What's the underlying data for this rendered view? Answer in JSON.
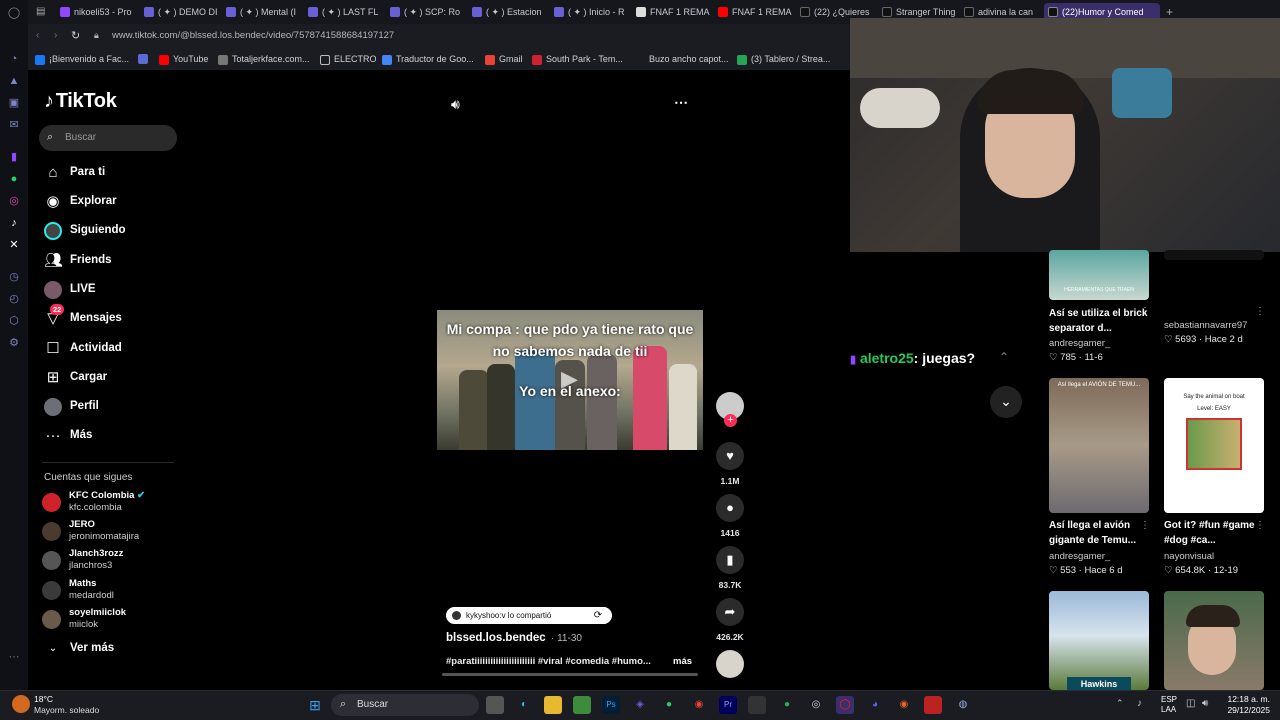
{
  "browser": {
    "tabs": [
      "nikoeli53 - Pro",
      "( ✦ ) DEMO DI",
      "( ✦ ) Mental (I",
      "( ✦ ) LAST FL",
      "( ✦ ) SCP: Ro",
      "( ✦ ) Estacion",
      "( ✦ ) Inicio - R",
      "FNAF 1 REMA",
      "FNAF 1 REMA",
      "(22) ¿Quieres",
      "Stranger Thing",
      "adivina la can",
      "(22)Humor y Comed"
    ],
    "url": "www.tiktok.com/@blssed.los.bendec/video/7578741588684197127",
    "bookmarks": [
      "¡Bienvenido a Fac...",
      "YouTube",
      "Totaljerkface.com...",
      "ELECTRO",
      "Traductor de Goo...",
      "Gmail",
      "South Park - Tem...",
      "Buzo ancho capot...",
      "(3) Tablero / Strea..."
    ]
  },
  "tiktok": {
    "logo": "TikTok",
    "search_placeholder": "Buscar",
    "nav": [
      {
        "label": "Para ti",
        "icon": "home-icon"
      },
      {
        "label": "Explorar",
        "icon": "compass-icon"
      },
      {
        "label": "Siguiendo",
        "icon": "following-icon"
      },
      {
        "label": "Friends",
        "icon": "friends-icon"
      },
      {
        "label": "LIVE",
        "icon": "live-icon"
      },
      {
        "label": "Mensajes",
        "icon": "messages-icon",
        "badge": "22"
      },
      {
        "label": "Actividad",
        "icon": "activity-icon"
      },
      {
        "label": "Cargar",
        "icon": "upload-icon"
      },
      {
        "label": "Perfil",
        "icon": "profile-icon"
      },
      {
        "label": "Más",
        "icon": "more-icon"
      }
    ],
    "following_title": "Cuentas que sigues",
    "following": [
      {
        "name": "KFC Colombia",
        "handle": "kfc.colombia",
        "verified": true
      },
      {
        "name": "JERO",
        "handle": "jeronimomatajira"
      },
      {
        "name": "Jlanch3rozz",
        "handle": "jlanchros3"
      },
      {
        "name": "Maths",
        "handle": "medardodl"
      },
      {
        "name": "soyelmiiclok",
        "handle": "miiclok"
      }
    ],
    "see_more": "Ver más"
  },
  "video": {
    "caption_top": "Mi compa : que pdo ya tiene rato que no sabemos nada de tii",
    "caption_bottom": "Yo en el anexo:",
    "likes": "1.1M",
    "comments": "1416",
    "saves": "83.7K",
    "shares": "426.2K",
    "shared_by": "kykyshoo:v lo compartió",
    "author": "blssed.los.bendec",
    "date": "· 11-30",
    "description": "#paratiiiiiiiiiiiiiiiiiiiiiii #viral #comedia #humo...",
    "more": "más"
  },
  "stream_overlay": {
    "user": "aletro25",
    "message": ": juegas?"
  },
  "grid": [
    {
      "title": "Así se utiliza el brick separator d...",
      "user": "andresgamer_",
      "stats": "♡ 785 · 11-6"
    },
    {
      "title": "",
      "user": "sebastiannavarre97",
      "stats": "♡ 5693 · Hace 2 d"
    },
    {
      "title": "Así llega el avión gigante de Temu...",
      "user": "andresgamer_",
      "stats": "♡ 553 · Hace 6 d"
    },
    {
      "title": "Got it? #fun #game #dog #ca...",
      "user": "nayonvisual",
      "stats": "♡ 654.8K · 12-19"
    },
    {
      "title": "",
      "user": "",
      "stats": ""
    },
    {
      "title": "",
      "user": "",
      "stats": ""
    }
  ],
  "grid_thumb_text": [
    "HERRAMIENTAS QUE TRAEN",
    "Así llega el AVIÓN DE TEMU...",
    "Say the animal on boat",
    "Level: EASY",
    "Hawkins"
  ],
  "taskbar": {
    "weather_temp": "18°C",
    "weather_desc": "Mayorm. soleado",
    "search": "Buscar",
    "lang1": "ESP",
    "lang2": "LAA",
    "time": "12:18 a. m.",
    "date": "29/12/2025"
  }
}
